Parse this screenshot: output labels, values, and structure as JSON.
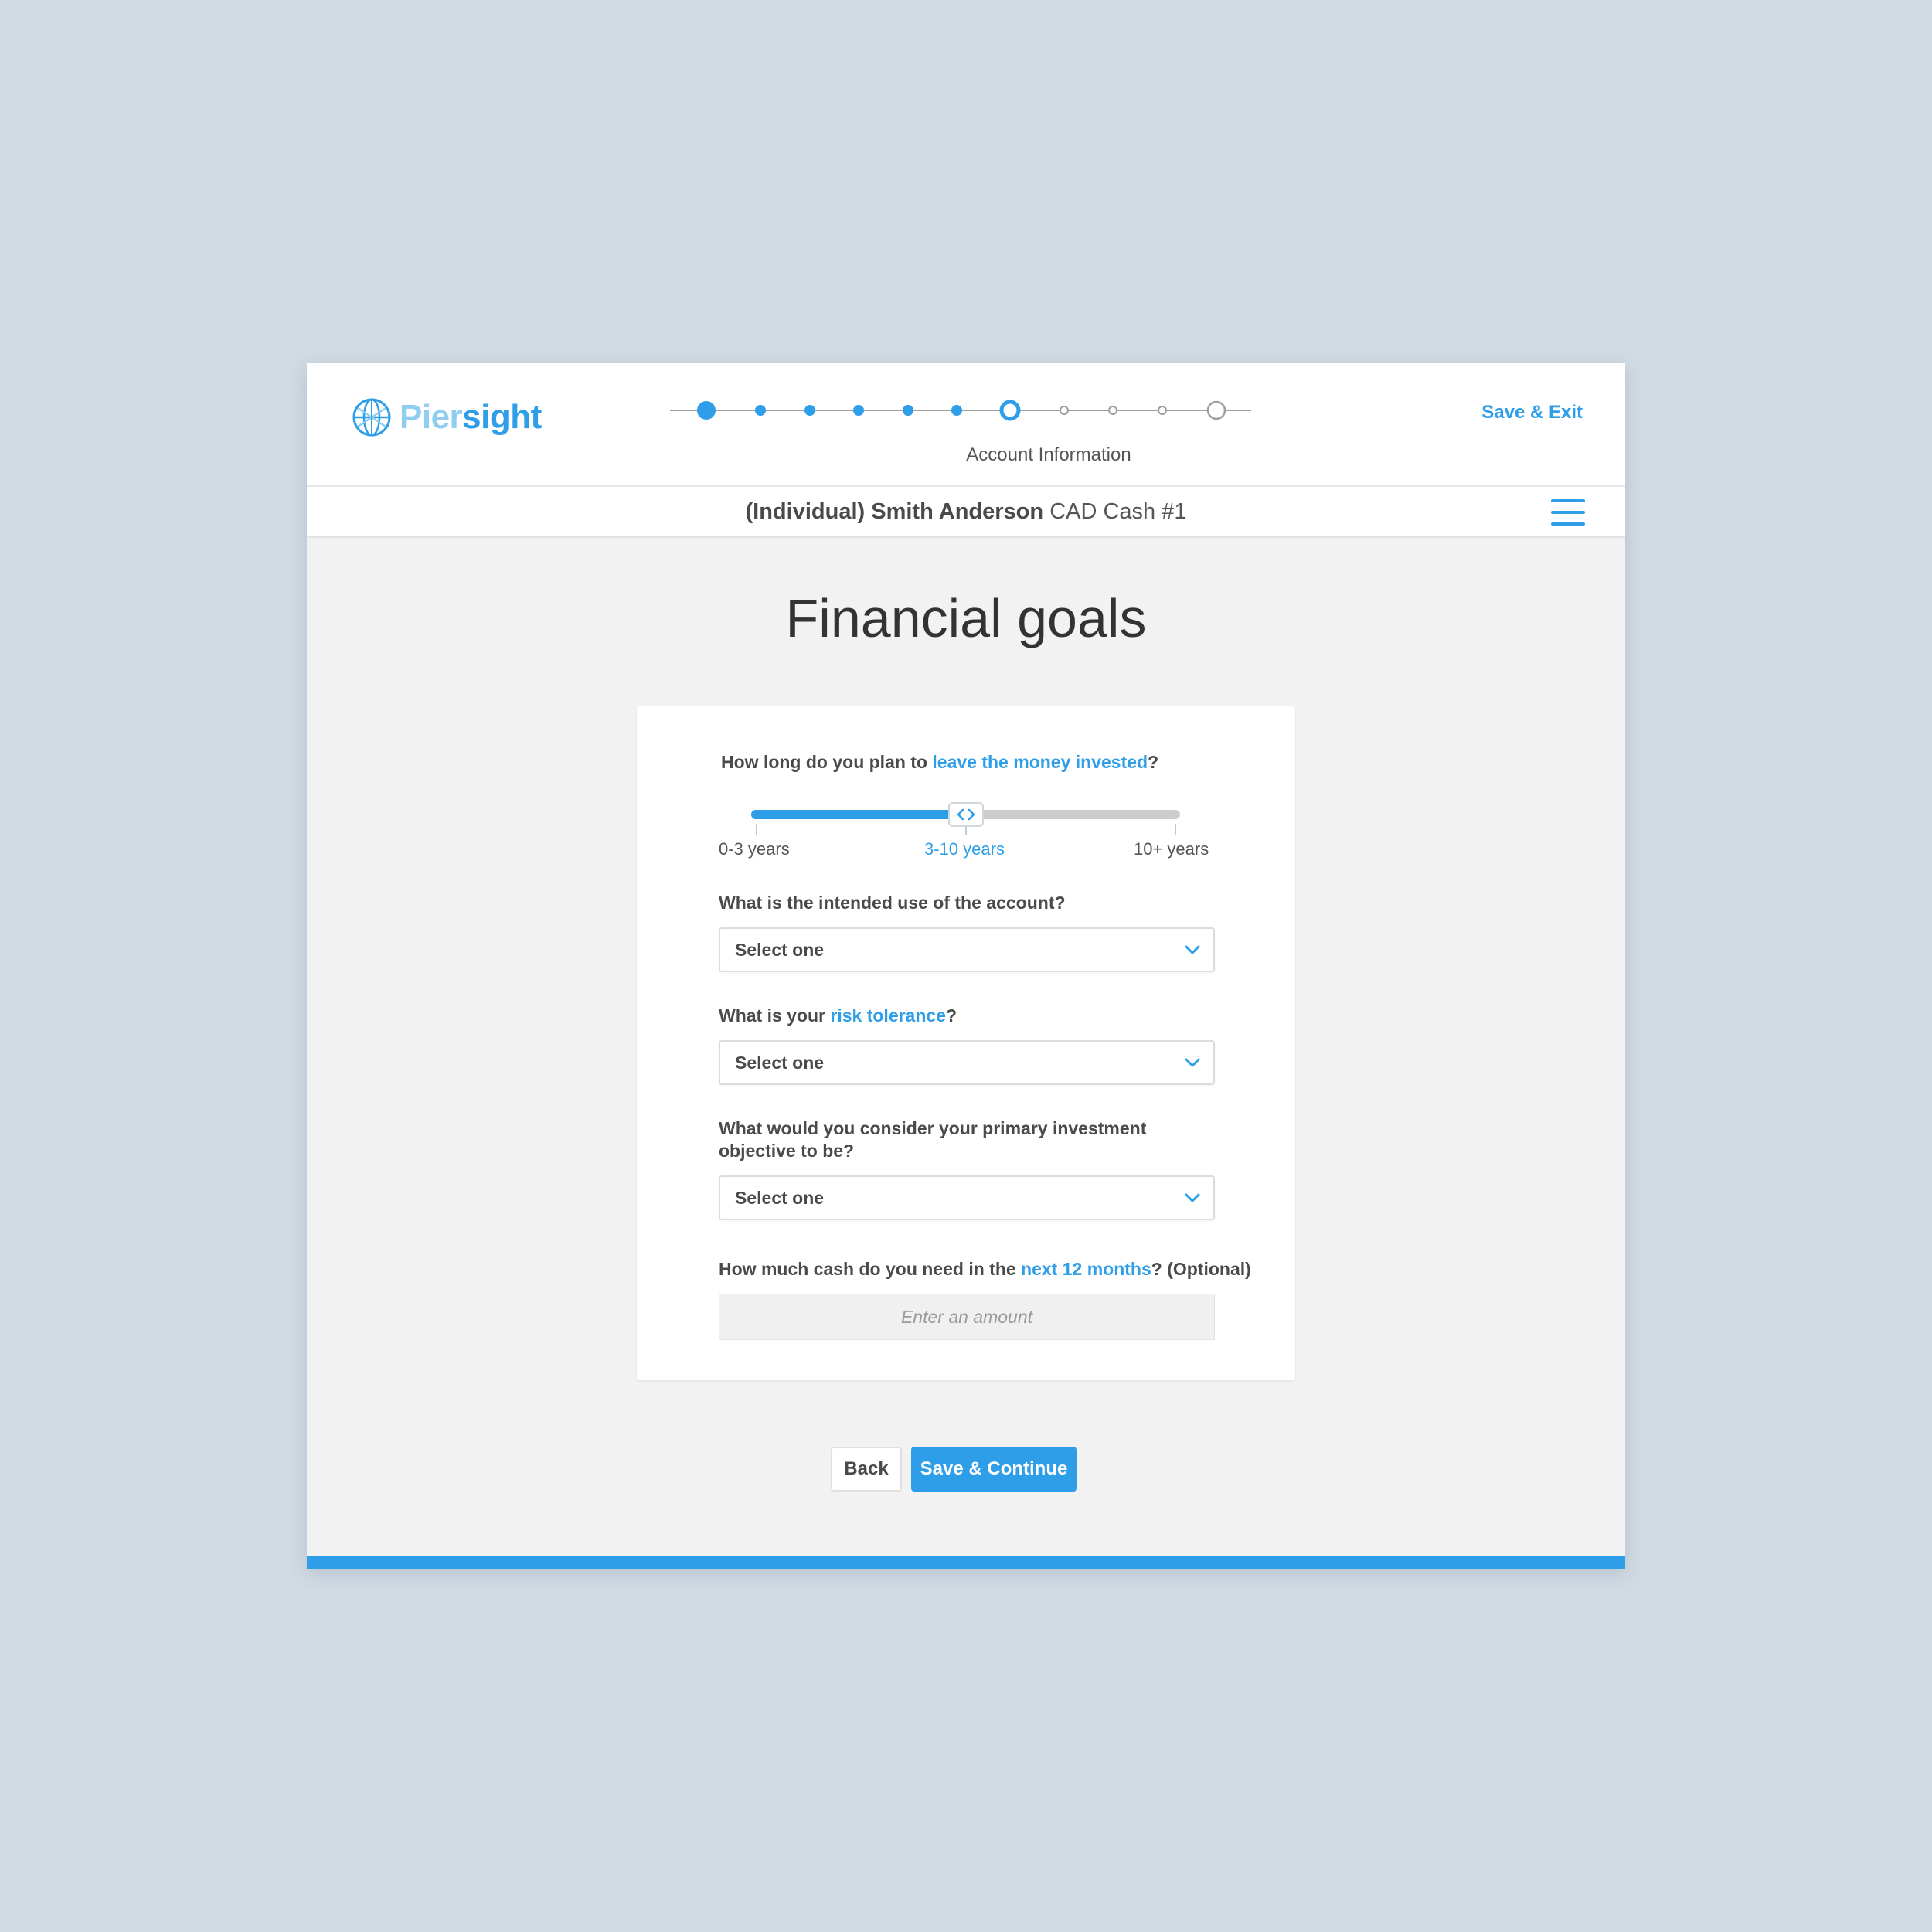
{
  "colors": {
    "accent": "#2f9ee8",
    "accent_light": "#8fcdf1",
    "background": "#d1dbe4",
    "panel": "#f2f2f2"
  },
  "header": {
    "logo": {
      "part1": "Pier",
      "part2": "sight",
      "icon": "globe-icon"
    },
    "stepper": {
      "current_label": "Account Information",
      "total_steps": 11,
      "current_step": 7
    },
    "save_exit_label": "Save & Exit"
  },
  "subheader": {
    "account_type": "(Individual)",
    "account_holder": "Smith Anderson",
    "account_name": "CAD Cash #1",
    "menu_icon": "hamburger-menu-icon"
  },
  "page": {
    "title": "Financial goals"
  },
  "form": {
    "q1": {
      "prefix": "How long do you plan to ",
      "link": "leave the money invested",
      "suffix": "?"
    },
    "horizon_slider": {
      "options": [
        "0-3 years",
        "3-10 years",
        "10+ years"
      ],
      "selected_index": 1,
      "value_fraction": 0.5
    },
    "q2": {
      "label": "What is the intended use of the account?",
      "value": "Select one"
    },
    "q3": {
      "prefix": "What is your ",
      "link": "risk tolerance",
      "suffix": "?",
      "value": "Select one"
    },
    "q4": {
      "line1": "What would you consider your primary investment",
      "line2": "objective to be?",
      "value": "Select one"
    },
    "q5": {
      "prefix": "How much cash do you need in the ",
      "link": "next 12 months",
      "suffix": "? (Optional)",
      "placeholder": "Enter an amount"
    }
  },
  "actions": {
    "back_label": "Back",
    "continue_label": "Save & Continue"
  }
}
